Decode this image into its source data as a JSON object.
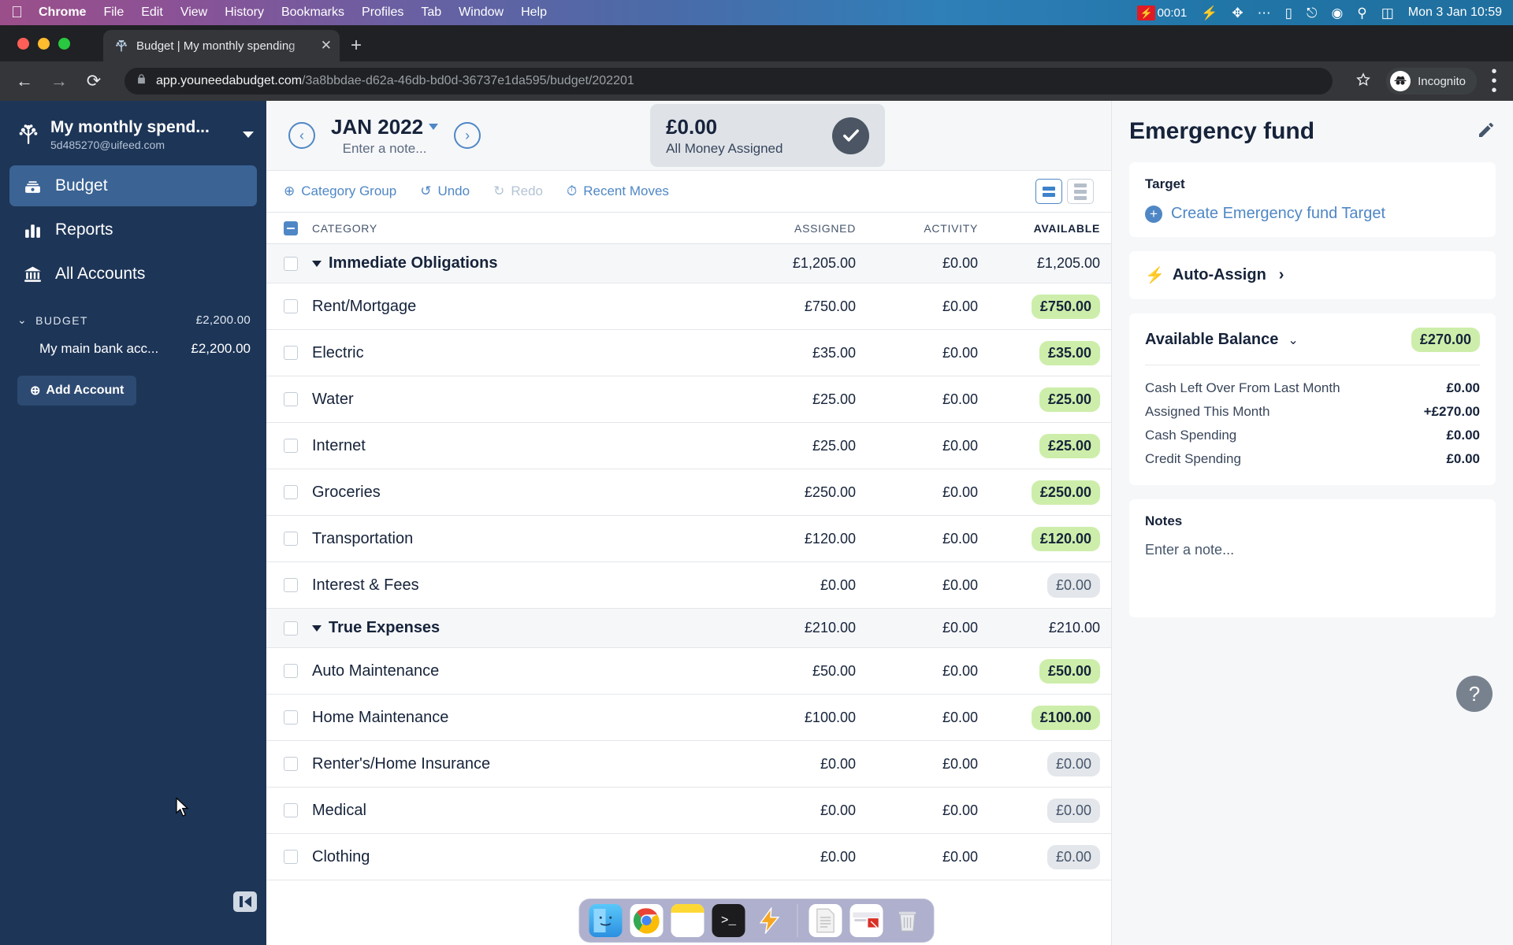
{
  "menubar": {
    "apple_icon": "apple-icon",
    "items": [
      {
        "label": "Chrome",
        "bold": true
      },
      {
        "label": "File",
        "bold": false
      },
      {
        "label": "Edit",
        "bold": false
      },
      {
        "label": "View",
        "bold": false
      },
      {
        "label": "History",
        "bold": false
      },
      {
        "label": "Bookmarks",
        "bold": false
      },
      {
        "label": "Profiles",
        "bold": false
      },
      {
        "label": "Tab",
        "bold": false
      },
      {
        "label": "Window",
        "bold": false
      },
      {
        "label": "Help",
        "bold": false
      }
    ],
    "recording_time": "00:01",
    "status_icons": [
      "bolt-icon",
      "bluetooth-off-icon",
      "dots-icon",
      "battery-icon",
      "wifi-icon",
      "user-icon",
      "search-icon",
      "control-center-icon"
    ],
    "clock": "Mon 3 Jan  10:59"
  },
  "browser": {
    "tab": {
      "title": "Budget | My monthly spending",
      "favicon": "ynab-tree-icon",
      "close_label": "✕"
    },
    "new_tab_label": "+",
    "back_label": "←",
    "forward_label": "→",
    "reload_label": "⟳",
    "url_host": "app.youneedabudget.com",
    "url_path": "/3a8bbdae-d62a-46db-bd0d-36737e1da595/budget/202201",
    "bookmark_icon": "star-icon",
    "profile_label": "Incognito",
    "menu_icon": "kebab-menu-icon"
  },
  "sidebar": {
    "budget_name": "My monthly spend...",
    "email": "5d485270@uifeed.com",
    "nav": [
      {
        "label": "Budget",
        "icon": "budget-icon",
        "active": true
      },
      {
        "label": "Reports",
        "icon": "bar-chart-icon",
        "active": false
      },
      {
        "label": "All Accounts",
        "icon": "bank-icon",
        "active": false
      }
    ],
    "accounts_header": {
      "label": "BUDGET",
      "amount": "£2,200.00"
    },
    "accounts": [
      {
        "name": "My main bank acc...",
        "amount": "£2,200.00"
      }
    ],
    "add_account_label": "Add Account"
  },
  "header": {
    "prev_label": "‹",
    "next_label": "›",
    "month": "JAN 2022",
    "note_placeholder": "Enter a note...",
    "assigned_amount": "£0.00",
    "assigned_label": "All Money Assigned",
    "check_icon": "check-circle-icon"
  },
  "toolbar": {
    "category_group": "Category Group",
    "undo": "Undo",
    "redo": "Redo",
    "recent_moves": "Recent Moves"
  },
  "table": {
    "columns": [
      "CATEGORY",
      "ASSIGNED",
      "ACTIVITY",
      "AVAILABLE"
    ],
    "rows": [
      {
        "type": "group",
        "name": "Immediate Obligations",
        "assigned": "£1,205.00",
        "activity": "£0.00",
        "available": "£1,205.00"
      },
      {
        "type": "category",
        "name": "Rent/Mortgage",
        "assigned": "£750.00",
        "activity": "£0.00",
        "available": "£750.00",
        "progress": 100,
        "funded": true
      },
      {
        "type": "category",
        "name": "Electric",
        "assigned": "£35.00",
        "activity": "£0.00",
        "available": "£35.00",
        "progress": 100,
        "funded": true
      },
      {
        "type": "category",
        "name": "Water",
        "assigned": "£25.00",
        "activity": "£0.00",
        "available": "£25.00",
        "progress": 100,
        "funded": true
      },
      {
        "type": "category",
        "name": "Internet",
        "assigned": "£25.00",
        "activity": "£0.00",
        "available": "£25.00",
        "progress": 100,
        "funded": true
      },
      {
        "type": "category",
        "name": "Groceries",
        "assigned": "£250.00",
        "activity": "£0.00",
        "available": "£250.00",
        "progress": 100,
        "funded": true
      },
      {
        "type": "category",
        "name": "Transportation",
        "assigned": "£120.00",
        "activity": "£0.00",
        "available": "£120.00",
        "progress": 100,
        "funded": true
      },
      {
        "type": "category",
        "name": "Interest & Fees",
        "assigned": "£0.00",
        "activity": "£0.00",
        "available": "£0.00",
        "progress": 0,
        "funded": false
      },
      {
        "type": "group",
        "name": "True Expenses",
        "assigned": "£210.00",
        "activity": "£0.00",
        "available": "£210.00"
      },
      {
        "type": "category",
        "name": "Auto Maintenance",
        "assigned": "£50.00",
        "activity": "£0.00",
        "available": "£50.00",
        "progress": 100,
        "funded": true
      },
      {
        "type": "category",
        "name": "Home Maintenance",
        "assigned": "£100.00",
        "activity": "£0.00",
        "available": "£100.00",
        "progress": 100,
        "funded": true
      },
      {
        "type": "category",
        "name": "Renter's/Home Insurance",
        "assigned": "£0.00",
        "activity": "£0.00",
        "available": "£0.00",
        "progress": 0,
        "funded": false
      },
      {
        "type": "category",
        "name": "Medical",
        "assigned": "£0.00",
        "activity": "£0.00",
        "available": "£0.00",
        "progress": 0,
        "funded": false
      },
      {
        "type": "category",
        "name": "Clothing",
        "assigned": "£0.00",
        "activity": "£0.00",
        "available": "£0.00",
        "progress": 0,
        "funded": false
      }
    ]
  },
  "inspector": {
    "title": "Emergency fund",
    "edit_icon": "pencil-icon",
    "target_label": "Target",
    "create_target_label": "Create Emergency fund Target",
    "auto_assign_label": "Auto-Assign",
    "balance_label": "Available Balance",
    "balance_amount": "£270.00",
    "balance_rows": [
      {
        "label": "Cash Left Over From Last Month",
        "value": "£0.00"
      },
      {
        "label": "Assigned This Month",
        "value": "+£270.00"
      },
      {
        "label": "Cash Spending",
        "value": "£0.00"
      },
      {
        "label": "Credit Spending",
        "value": "£0.00"
      }
    ],
    "notes_label": "Notes",
    "notes_placeholder": "Enter a note...",
    "help_label": "?"
  },
  "dock": {
    "items": [
      {
        "name": "finder-icon",
        "running": true
      },
      {
        "name": "chrome-icon",
        "running": true
      },
      {
        "name": "notes-icon",
        "running": true
      },
      {
        "name": "terminal-icon",
        "running": true
      },
      {
        "name": "bolt-app-icon",
        "running": true
      },
      {
        "name": "document-icon",
        "running": false
      },
      {
        "name": "screenshot-icon",
        "running": false
      },
      {
        "name": "trash-icon",
        "running": false
      }
    ]
  },
  "colors": {
    "accent_blue": "#4f87c6",
    "sidebar_navy": "#1d3557",
    "progress_green": "#76b648",
    "pill_green": "#cdeeaa"
  }
}
